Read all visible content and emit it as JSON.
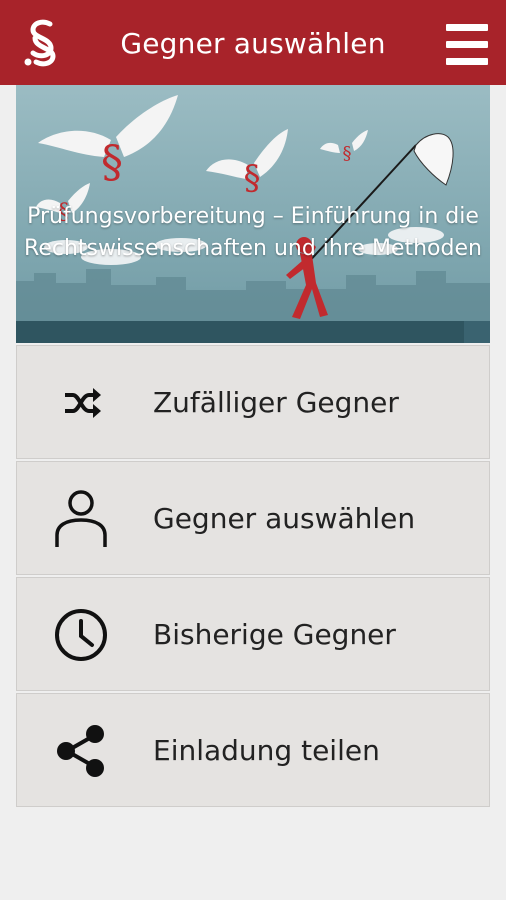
{
  "app_bar": {
    "title": "Gegner auswählen",
    "logo_icon": "paragraph-logo-icon",
    "menu_icon": "hamburger-menu-icon",
    "background_color": "#a8232a"
  },
  "banner": {
    "title": "Prüfungsvorbereitung – Einführung in die Rechtswissenschaften und ihre Methoden",
    "image": "winged-paragraph-symbols-illustration"
  },
  "menu": {
    "items": [
      {
        "label": "Zufälliger Gegner",
        "icon": "shuffle-icon"
      },
      {
        "label": "Gegner auswählen",
        "icon": "person-icon"
      },
      {
        "label": "Bisherige Gegner",
        "icon": "clock-icon"
      },
      {
        "label": "Einladung teilen",
        "icon": "share-icon"
      }
    ]
  }
}
